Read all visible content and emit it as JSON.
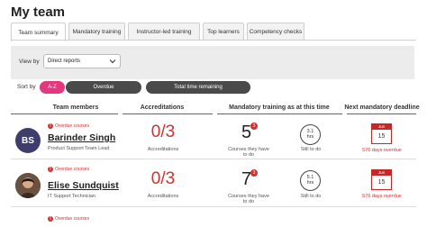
{
  "page": {
    "title": "My team"
  },
  "tabs": [
    "Team summary",
    "Mandatory training",
    "Instructor-led training",
    "Top learners",
    "Competency checks"
  ],
  "filters": {
    "view_by_label": "View by",
    "view_by_value": "Direct reports"
  },
  "sort": {
    "label": "Sort by",
    "options": [
      "A-Z",
      "Overdue",
      "Total time remaining"
    ]
  },
  "columns": {
    "team_members": "Team members",
    "accreditations": "Accreditations",
    "mandatory": "Mandatory training as at this time",
    "next_deadline": "Next mandatory deadline"
  },
  "members": [
    {
      "initials": "BS",
      "overdue": "Overdue courses",
      "name": "Barinder Singh",
      "role": "Product Support Team Lead",
      "accreditations": "0/3",
      "accreditations_label": "Accreditations",
      "courses": "5",
      "courses_badge": "3",
      "courses_label": "Courses they have to do",
      "hours": "3.1",
      "hours_unit": "hrs",
      "hours_label": "Still to do",
      "deadline_month": "Jun",
      "deadline_day": "15",
      "deadline_overdue": "576 days overdue"
    },
    {
      "initials": "",
      "overdue": "Overdue courses",
      "name": "Elise Sundquist",
      "role": "IT Support Technician",
      "accreditations": "0/3",
      "accreditations_label": "Accreditations",
      "courses": "7",
      "courses_badge": "3",
      "courses_label": "Courses they have to do",
      "hours": "5.1",
      "hours_unit": "hrs",
      "hours_label": "Still to do",
      "deadline_month": "Jun",
      "deadline_day": "15",
      "deadline_overdue": "576 days overdue"
    },
    {
      "overdue": "Overdue courses"
    }
  ]
}
